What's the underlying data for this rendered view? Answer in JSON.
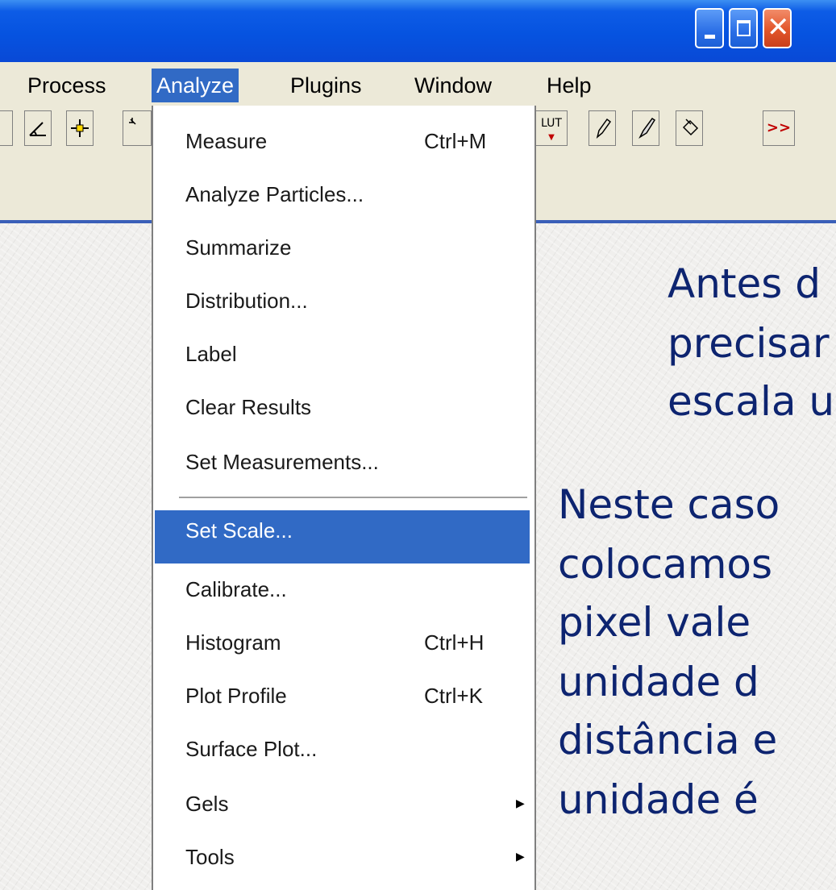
{
  "menubar": {
    "items": [
      {
        "label": "Process"
      },
      {
        "label": "Analyze"
      },
      {
        "label": "Plugins"
      },
      {
        "label": "Window"
      },
      {
        "label": "Help"
      }
    ],
    "active": "Analyze"
  },
  "toolbar": {
    "lut_label": "LUT",
    "more_label": ">>"
  },
  "dropdown": {
    "items": [
      {
        "label": "Measure",
        "shortcut": "Ctrl+M"
      },
      {
        "label": "Analyze Particles...",
        "shortcut": ""
      },
      {
        "label": "Summarize",
        "shortcut": ""
      },
      {
        "label": "Distribution...",
        "shortcut": ""
      },
      {
        "label": "Label",
        "shortcut": ""
      },
      {
        "label": "Clear Results",
        "shortcut": ""
      },
      {
        "label": "Set Measurements...",
        "shortcut": ""
      },
      {
        "label": "Set Scale...",
        "shortcut": ""
      },
      {
        "label": "Calibrate...",
        "shortcut": ""
      },
      {
        "label": "Histogram",
        "shortcut": "Ctrl+H"
      },
      {
        "label": "Plot Profile",
        "shortcut": "Ctrl+K"
      },
      {
        "label": "Surface Plot...",
        "shortcut": ""
      },
      {
        "label": "Gels",
        "shortcut": "",
        "submenu": true
      },
      {
        "label": "Tools",
        "shortcut": "",
        "submenu": true
      }
    ],
    "highlighted": "Set Scale..."
  },
  "slide": {
    "lines": [
      "Antes d",
      "precisar",
      "escala u",
      "Neste caso",
      "colocamos",
      "pixel vale",
      "unidade d",
      "distância e",
      "unidade é"
    ]
  },
  "colors": {
    "titlebar": "#0653e0",
    "menu_highlight": "#316ac5",
    "slide_text": "#0d2470",
    "window_chrome": "#ece9d8"
  }
}
